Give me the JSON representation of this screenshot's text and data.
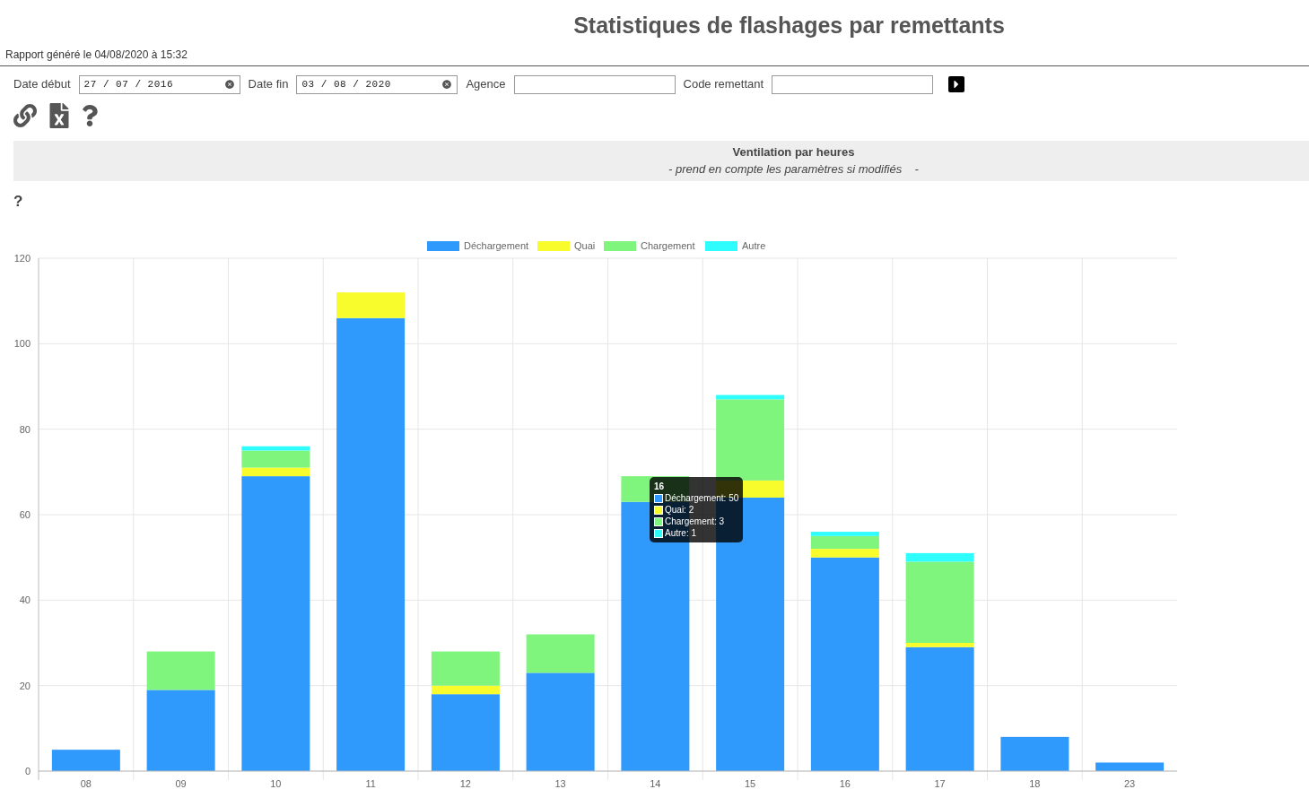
{
  "title": "Statistiques de flashages par remettants",
  "report_info": "Rapport généré le 04/08/2020 à 15:32",
  "filters": [
    {
      "kind": "date",
      "label": "Date début",
      "value": "27 / 07 / 2016"
    },
    {
      "kind": "date",
      "label": "Date fin",
      "value": "03 / 08 / 2020"
    },
    {
      "kind": "text",
      "label": "Agence"
    },
    {
      "kind": "text",
      "label": "Code remettant"
    }
  ],
  "section": {
    "title": "Ventilation par heures",
    "subtitle": "- prend en compte les paramètres si modifiés    -"
  },
  "help_mark": "?",
  "chart_data": {
    "type": "bar",
    "stacked": true,
    "grid": true,
    "legend": true,
    "categories": [
      "08",
      "09",
      "10",
      "11",
      "12",
      "13",
      "14",
      "15",
      "16",
      "17",
      "18",
      "23"
    ],
    "ylim": [
      0,
      120
    ],
    "yticks": [
      0,
      20,
      40,
      60,
      80,
      100,
      120
    ],
    "series": [
      {
        "name": "Déchargement",
        "color": "#2f99fc",
        "values": [
          5,
          19,
          69,
          106,
          18,
          23,
          63,
          64,
          50,
          29,
          8,
          2
        ]
      },
      {
        "name": "Quai",
        "color": "#f8fc2c",
        "values": [
          0,
          0,
          2,
          6,
          2,
          0,
          0,
          4,
          2,
          1,
          0,
          0
        ]
      },
      {
        "name": "Chargement",
        "color": "#80f57e",
        "values": [
          0,
          9,
          4,
          0,
          8,
          9,
          6,
          19,
          3,
          19,
          0,
          0
        ]
      },
      {
        "name": "Autre",
        "color": "#2ffcfc",
        "values": [
          0,
          0,
          1,
          0,
          0,
          0,
          0,
          1,
          1,
          2,
          0,
          0
        ]
      }
    ]
  },
  "tooltip": {
    "title": "16",
    "lines": [
      {
        "text": "Déchargement: 50",
        "color": "#2f99fc"
      },
      {
        "text": "Quai: 2",
        "color": "#f8fc2c"
      },
      {
        "text": "Chargement: 3",
        "color": "#80f57e"
      },
      {
        "text": "Autre: 1",
        "color": "#2ffcfc"
      }
    ]
  }
}
